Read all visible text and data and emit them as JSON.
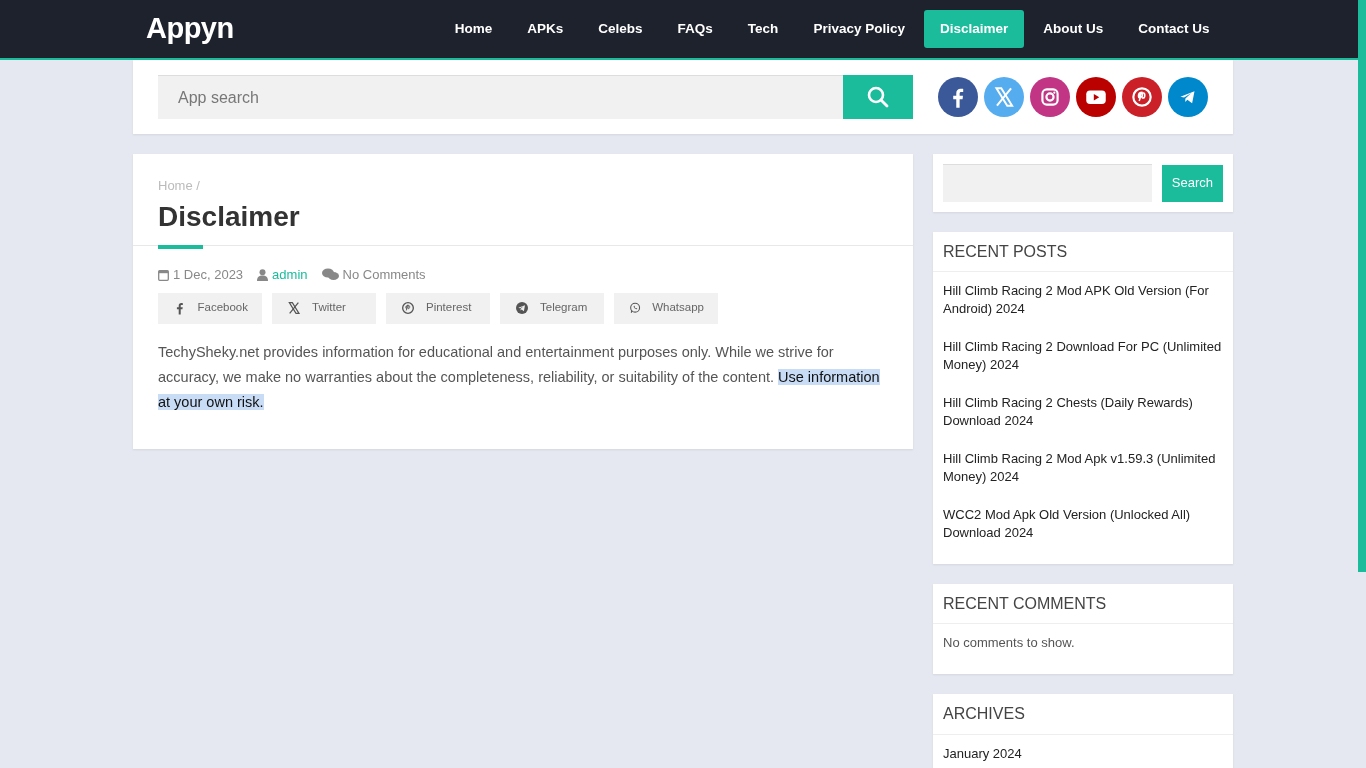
{
  "header": {
    "logo": "Appyn",
    "nav": [
      {
        "label": "Home",
        "selected": false
      },
      {
        "label": "APKs",
        "selected": false
      },
      {
        "label": "Celebs",
        "selected": false
      },
      {
        "label": "FAQs",
        "selected": false
      },
      {
        "label": "Tech",
        "selected": false
      },
      {
        "label": "Privacy Policy",
        "selected": false
      },
      {
        "label": "Disclaimer",
        "selected": true
      },
      {
        "label": "About Us",
        "selected": false
      },
      {
        "label": "Contact Us",
        "selected": false
      }
    ]
  },
  "search_bar": {
    "placeholder": "App search",
    "social": [
      {
        "kind": "facebook",
        "color": "#3b5998"
      },
      {
        "kind": "x",
        "color": "#55acee"
      },
      {
        "kind": "instagram",
        "color": "#c13584"
      },
      {
        "kind": "youtube",
        "color": "#bb0000"
      },
      {
        "kind": "pinterest",
        "color": "#cb2027"
      },
      {
        "kind": "telegram",
        "color": "#0088cc"
      }
    ]
  },
  "article": {
    "breadcrumb": "Home /",
    "title": "Disclaimer",
    "date": "1 Dec, 2023",
    "author": "admin",
    "comments": "No Comments",
    "share": [
      {
        "kind": "facebook",
        "label": "Facebook"
      },
      {
        "kind": "x",
        "label": "Twitter"
      },
      {
        "kind": "pinterest",
        "label": "Pinterest"
      },
      {
        "kind": "telegram",
        "label": "Telegram"
      },
      {
        "kind": "whatsapp",
        "label": "Whatsapp"
      }
    ],
    "body": {
      "text": "TechySheky.net provides information for educational and entertainment purposes only. While we strive for accuracy, we make no warranties about the completeness, reliability, or suitability of the content.",
      "selected_text": "Use information at your own risk."
    }
  },
  "sidebar": {
    "search_button": "Search",
    "widgets": [
      {
        "title": "RECENT POSTS",
        "kind": "links",
        "items": [
          "Hill Climb Racing 2 Mod APK Old Version (For Android) 2024",
          "Hill Climb Racing 2 Download For PC (Unlimited Money) 2024",
          "Hill Climb Racing 2 Chests (Daily Rewards) Download 2024",
          "Hill Climb Racing 2 Mod Apk v1.59.3 (Unlimited Money) 2024",
          "WCC2 Mod Apk Old Version (Unlocked All) Download 2024"
        ]
      },
      {
        "title": "RECENT COMMENTS",
        "kind": "note",
        "items": [
          "No comments to show."
        ]
      },
      {
        "title": "ARCHIVES",
        "kind": "links",
        "items": [
          "January 2024"
        ]
      }
    ]
  }
}
